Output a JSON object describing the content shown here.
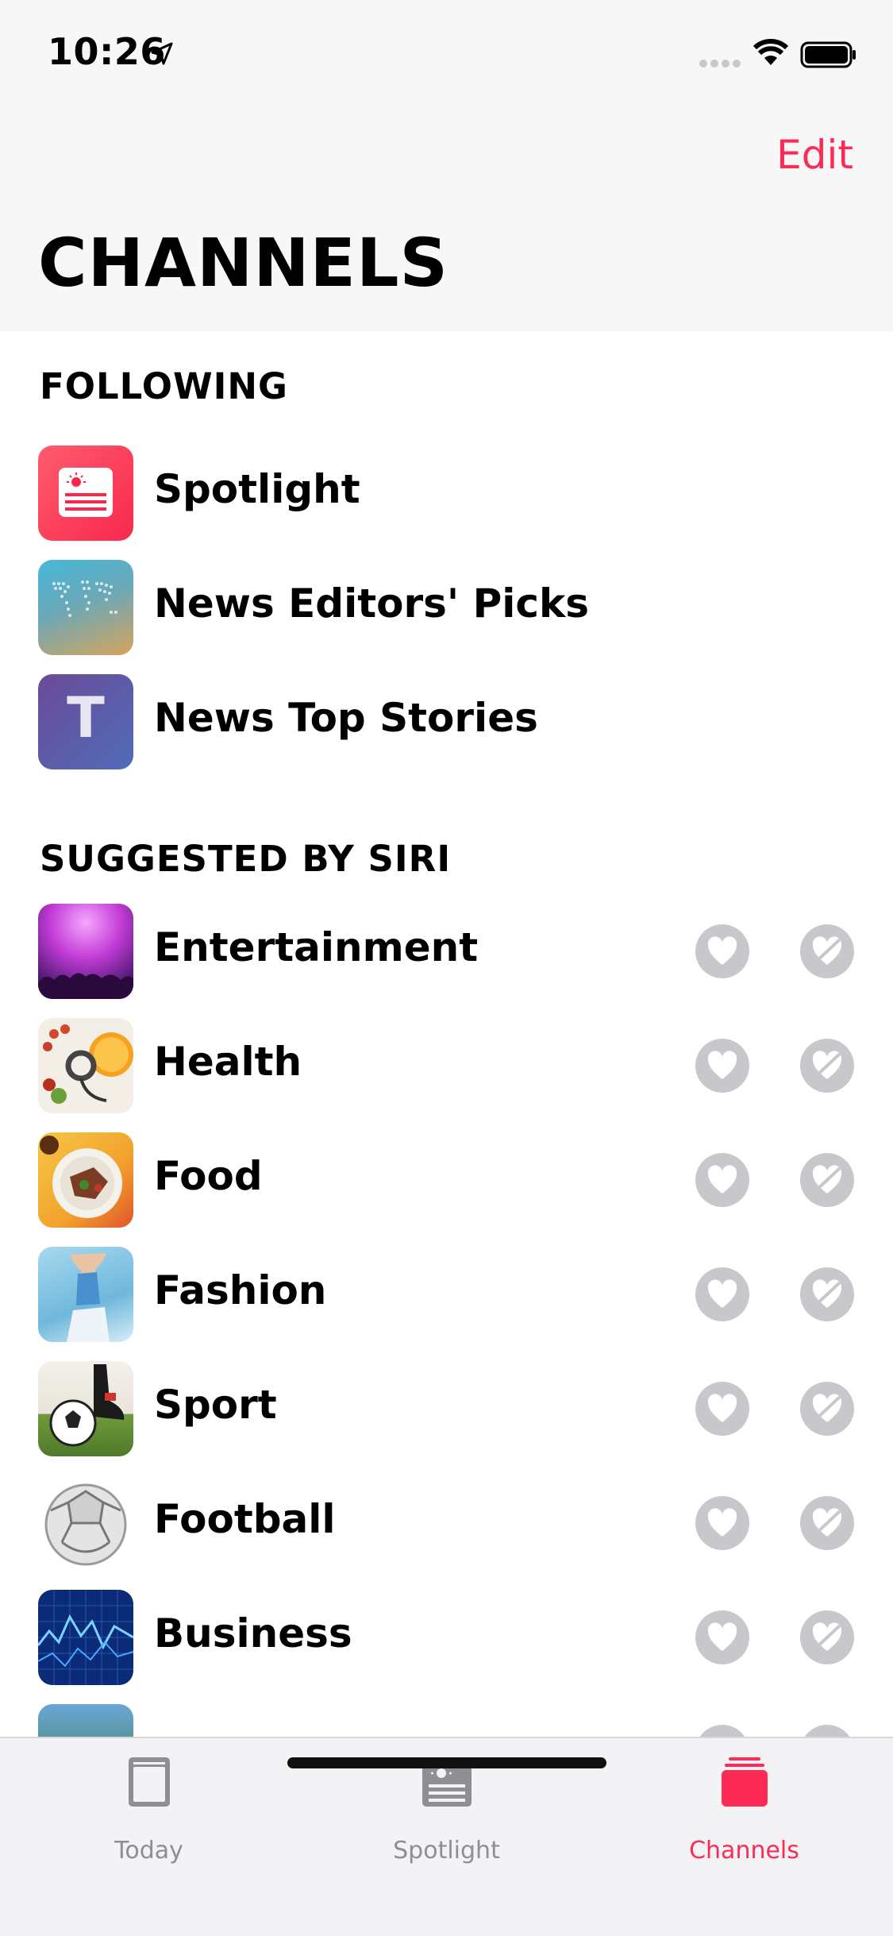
{
  "status_bar": {
    "time": "10:26"
  },
  "header": {
    "edit_label": "Edit",
    "title": "CHANNELS"
  },
  "sections": {
    "following": {
      "title": "FOLLOWING",
      "items": [
        {
          "label": "Spotlight"
        },
        {
          "label": "News Editors' Picks"
        },
        {
          "label": "News Top Stories",
          "icon_letter": "T"
        }
      ]
    },
    "suggested": {
      "title": "SUGGESTED BY SIRI",
      "items": [
        {
          "label": "Entertainment"
        },
        {
          "label": "Health"
        },
        {
          "label": "Food"
        },
        {
          "label": "Fashion"
        },
        {
          "label": "Sport"
        },
        {
          "label": "Football"
        },
        {
          "label": "Business"
        }
      ]
    }
  },
  "tabbar": {
    "tabs": [
      {
        "label": "Today"
      },
      {
        "label": "Spotlight"
      },
      {
        "label": "Channels"
      }
    ]
  },
  "colors": {
    "accent": "#fb2b55",
    "inactive": "#8e8e93"
  }
}
